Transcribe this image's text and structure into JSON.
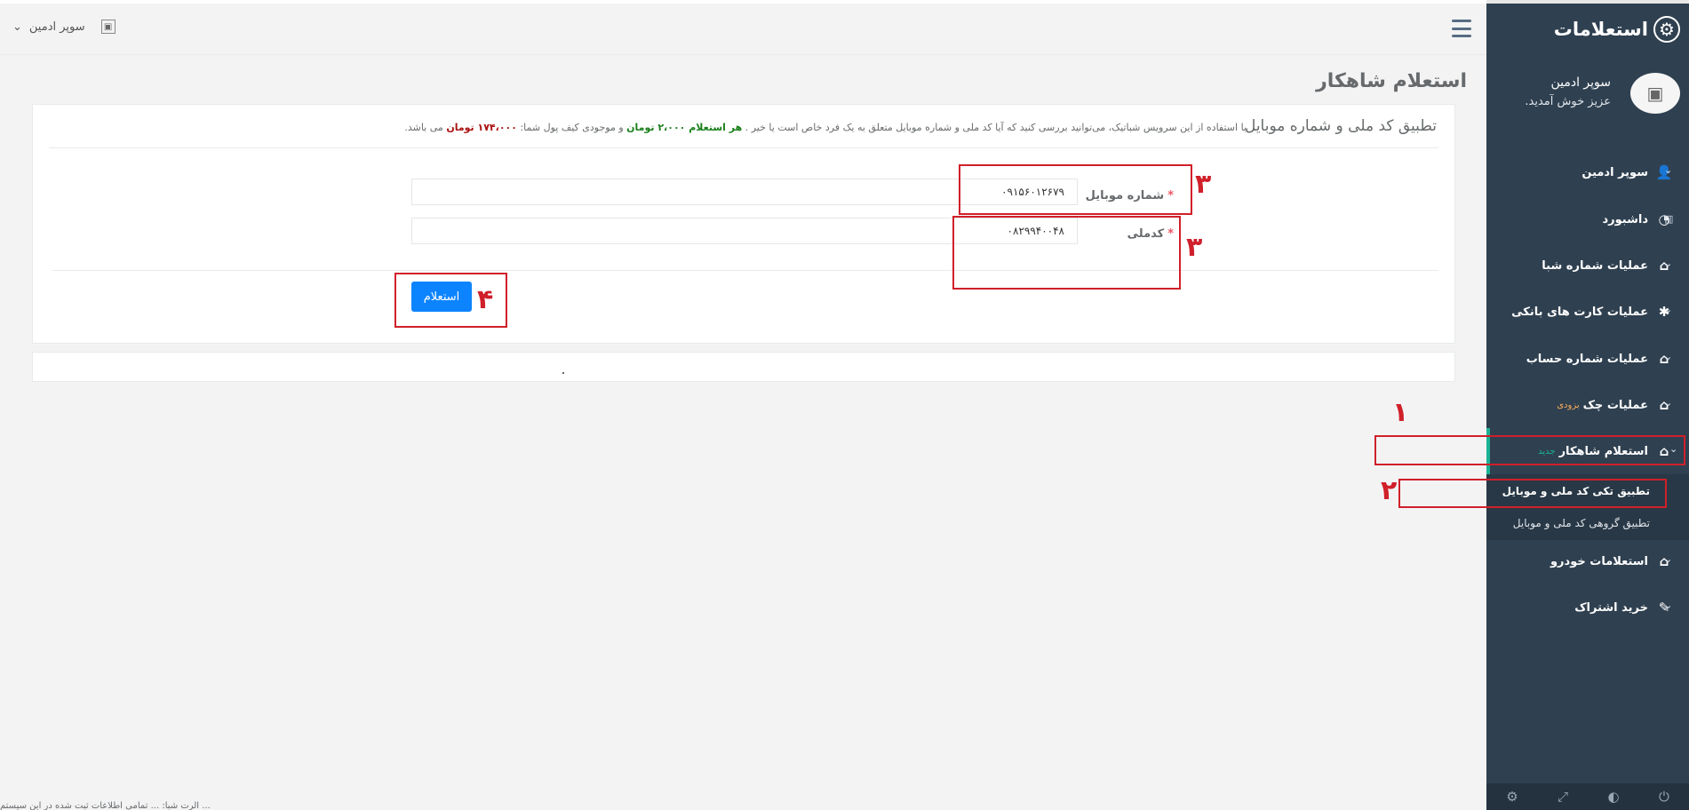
{
  "sidebar": {
    "title": "استعلامات",
    "gear_icon": "gear-icon",
    "profile": {
      "name": "سوپر ادمین",
      "welcome": "عزیز خوش آمدید."
    },
    "items": [
      {
        "label": "سوپر ادمین",
        "icon": "user-icon"
      },
      {
        "label": "داشبورد",
        "icon": "dashboard-icon"
      },
      {
        "label": "عملیات شماره شبا",
        "icon": "home-icon"
      },
      {
        "label": "عملیات کارت های بانکی",
        "icon": "bug-icon"
      },
      {
        "label": "عملیات شماره حساب",
        "icon": "home-icon"
      },
      {
        "label": "عملیات چک",
        "badge": "بزودی",
        "icon": "home-icon"
      },
      {
        "label": "استعلام شاهکار",
        "badge": "جدید",
        "icon": "home-icon"
      },
      {
        "label": "استعلامات خودرو",
        "icon": "home-icon"
      },
      {
        "label": "خرید اشتراک",
        "icon": "edit-icon"
      }
    ],
    "submenu": [
      {
        "label": "تطبیق تکی کد ملی و موبایل"
      },
      {
        "label": "تطبیق گروهی کد ملی و موبایل"
      }
    ]
  },
  "topbar": {
    "user_name": "سوپر ادمین"
  },
  "page": {
    "title": "استعلام شاهکار",
    "panel_title": "تطبیق کد ملی و شماره موبایل",
    "desc_1": "با استفاده از این سرویس شباتیک، می‌توانید بررسی کنید که آیا کد ملی و شماره موبایل متعلق به یک فرد خاص است یا خیر .",
    "desc_price": "هر استعلام ۲،۰۰۰ تومان",
    "desc_2": "و موجودی کیف پول شما:",
    "desc_balance": "۱۷۴،۰۰۰ تومان",
    "desc_3": "می باشد."
  },
  "form": {
    "mobile_label": "شماره موبایل",
    "mobile_value": "۰۹۱۵۶۰۱۲۶۷۹",
    "national_label": "کدملی",
    "national_value": "۰۸۲۹۹۴۰۰۴۸",
    "required_mark": "*",
    "submit_label": "استعلام"
  },
  "annotations": [
    "۱",
    "۲",
    "۳",
    "۳",
    "۴"
  ],
  "footer": {
    "text": "آلرت شبا: ... تمامی اطلاعات ثبت شده در این سیستم ..."
  },
  "colors": {
    "sidebar_bg": "#2f4050",
    "accent_green": "#1ab394",
    "primary_button": "#0d84ff",
    "annotation_red": "#d0202a"
  }
}
